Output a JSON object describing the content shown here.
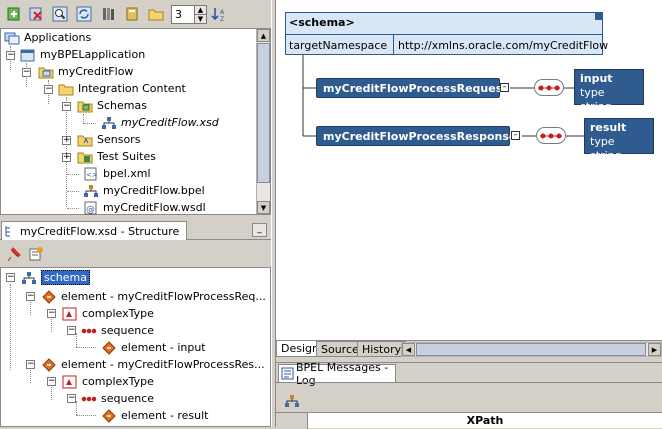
{
  "toolbar": {
    "spinner_value": "3"
  },
  "nav_tree": {
    "items": [
      {
        "label": "Applications"
      },
      {
        "label": "myBPELapplication"
      },
      {
        "label": "myCreditFlow"
      },
      {
        "label": "Integration Content"
      },
      {
        "label": "Schemas"
      },
      {
        "label": "myCreditFlow.xsd"
      },
      {
        "label": "Sensors"
      },
      {
        "label": "Test Suites"
      },
      {
        "label": "bpel.xml"
      },
      {
        "label": "myCreditFlow.bpel"
      },
      {
        "label": "myCreditFlow.wsdl"
      }
    ]
  },
  "structure": {
    "title": "myCreditFlow.xsd - Structure",
    "items": [
      {
        "label": "schema"
      },
      {
        "label": "element - myCreditFlowProcessReq..."
      },
      {
        "label": "complexType"
      },
      {
        "label": "sequence"
      },
      {
        "label": "element - input"
      },
      {
        "label": "element - myCreditFlowProcessRes..."
      },
      {
        "label": "complexType"
      },
      {
        "label": "sequence"
      },
      {
        "label": "element - result"
      }
    ]
  },
  "diagram": {
    "schema_header": "<schema>",
    "target_label": "targetNamespace",
    "target_value": "http://xmlns.oracle.com/myCreditFlow",
    "request": "myCreditFlowProcessRequest",
    "response": "myCreditFlowProcessResponse",
    "input_name": "input",
    "input_type": "type string",
    "result_name": "result",
    "result_type": "type string"
  },
  "tabs": {
    "design": "Design",
    "source": "Source",
    "history": "History"
  },
  "log": {
    "title": "BPEL Messages - Log",
    "col_xpath": "XPath"
  },
  "colors": {
    "node_blue": "#2f5b8e",
    "header_blue": "#d8e6f6",
    "selection": "#316ac5"
  }
}
